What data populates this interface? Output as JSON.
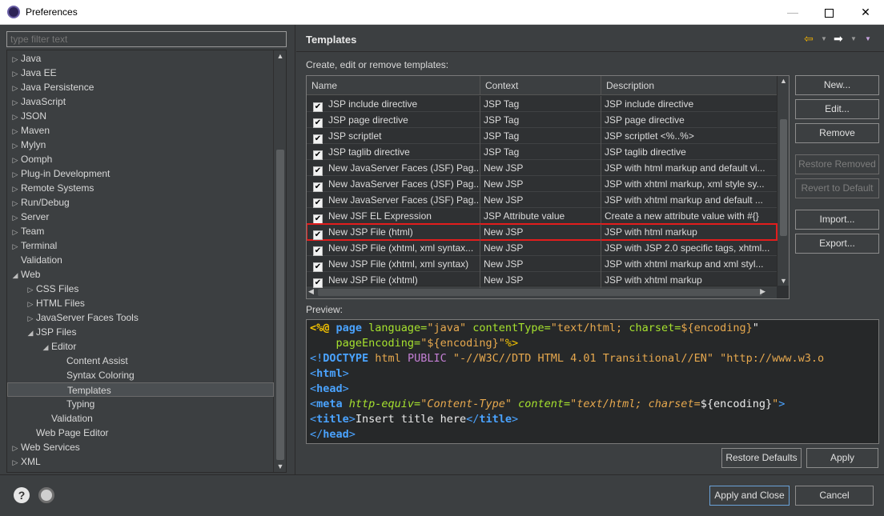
{
  "window": {
    "title": "Preferences"
  },
  "filter": {
    "placeholder": "type filter text"
  },
  "tree": [
    {
      "label": "Java",
      "level": 0,
      "arrow": "▷"
    },
    {
      "label": "Java EE",
      "level": 0,
      "arrow": "▷"
    },
    {
      "label": "Java Persistence",
      "level": 0,
      "arrow": "▷"
    },
    {
      "label": "JavaScript",
      "level": 0,
      "arrow": "▷"
    },
    {
      "label": "JSON",
      "level": 0,
      "arrow": "▷"
    },
    {
      "label": "Maven",
      "level": 0,
      "arrow": "▷"
    },
    {
      "label": "Mylyn",
      "level": 0,
      "arrow": "▷"
    },
    {
      "label": "Oomph",
      "level": 0,
      "arrow": "▷"
    },
    {
      "label": "Plug-in Development",
      "level": 0,
      "arrow": "▷"
    },
    {
      "label": "Remote Systems",
      "level": 0,
      "arrow": "▷"
    },
    {
      "label": "Run/Debug",
      "level": 0,
      "arrow": "▷"
    },
    {
      "label": "Server",
      "level": 0,
      "arrow": "▷"
    },
    {
      "label": "Team",
      "level": 0,
      "arrow": "▷"
    },
    {
      "label": "Terminal",
      "level": 0,
      "arrow": "▷"
    },
    {
      "label": "Validation",
      "level": 0,
      "arrow": ""
    },
    {
      "label": "Web",
      "level": 0,
      "arrow": "◢"
    },
    {
      "label": "CSS Files",
      "level": 1,
      "arrow": "▷"
    },
    {
      "label": "HTML Files",
      "level": 1,
      "arrow": "▷"
    },
    {
      "label": "JavaServer Faces Tools",
      "level": 1,
      "arrow": "▷"
    },
    {
      "label": "JSP Files",
      "level": 1,
      "arrow": "◢"
    },
    {
      "label": "Editor",
      "level": 2,
      "arrow": "◢"
    },
    {
      "label": "Content Assist",
      "level": 3,
      "arrow": ""
    },
    {
      "label": "Syntax Coloring",
      "level": 3,
      "arrow": ""
    },
    {
      "label": "Templates",
      "level": 3,
      "arrow": "",
      "selected": true
    },
    {
      "label": "Typing",
      "level": 3,
      "arrow": ""
    },
    {
      "label": "Validation",
      "level": 2,
      "arrow": ""
    },
    {
      "label": "Web Page Editor",
      "level": 1,
      "arrow": ""
    },
    {
      "label": "Web Services",
      "level": 0,
      "arrow": "▷"
    },
    {
      "label": "XML",
      "level": 0,
      "arrow": "▷"
    }
  ],
  "panel": {
    "title": "Templates",
    "subtitle": "Create, edit or remove templates:",
    "preview_label": "Preview:"
  },
  "table": {
    "columns": [
      "Name",
      "Context",
      "Description"
    ],
    "rows": [
      {
        "name": "JSP include directive",
        "context": "JSP Tag",
        "description": "JSP include directive",
        "checked": true
      },
      {
        "name": "JSP page directive",
        "context": "JSP Tag",
        "description": "JSP page directive",
        "checked": true
      },
      {
        "name": "JSP scriptlet",
        "context": "JSP Tag",
        "description": "JSP scriptlet <%..%>",
        "checked": true
      },
      {
        "name": "JSP taglib directive",
        "context": "JSP Tag",
        "description": "JSP taglib directive",
        "checked": true
      },
      {
        "name": "New JavaServer Faces (JSF) Pag...",
        "context": "New JSP",
        "description": "JSP with html markup and default vi...",
        "checked": true
      },
      {
        "name": "New JavaServer Faces (JSF) Pag...",
        "context": "New JSP",
        "description": "JSP with xhtml markup, xml style sy...",
        "checked": true
      },
      {
        "name": "New JavaServer Faces (JSF) Pag...",
        "context": "New JSP",
        "description": "JSP with xhtml markup and default ...",
        "checked": true
      },
      {
        "name": "New JSF EL Expression",
        "context": "JSP Attribute value",
        "description": "Create a new attribute value with #{}",
        "checked": true
      },
      {
        "name": "New JSP File (html)",
        "context": "New JSP",
        "description": "JSP with html markup",
        "checked": true,
        "highlight": true
      },
      {
        "name": "New JSP File (xhtml, xml syntax...",
        "context": "New JSP",
        "description": "JSP with JSP 2.0 specific tags, xhtml...",
        "checked": true
      },
      {
        "name": "New JSP File (xhtml, xml syntax)",
        "context": "New JSP",
        "description": "JSP with xhtml markup and xml styl...",
        "checked": true
      },
      {
        "name": "New JSP File (xhtml)",
        "context": "New JSP",
        "description": "JSP with xhtml markup",
        "checked": true
      }
    ]
  },
  "side_buttons": [
    {
      "name": "new-button",
      "label": "New...",
      "enabled": true
    },
    {
      "name": "edit-button",
      "label": "Edit...",
      "enabled": true
    },
    {
      "name": "remove-button",
      "label": "Remove",
      "enabled": true
    },
    {
      "name": "restore-removed-button",
      "label": "Restore Removed",
      "enabled": false
    },
    {
      "name": "revert-to-default-button",
      "label": "Revert to Default",
      "enabled": false
    },
    {
      "name": "import-button",
      "label": "Import...",
      "enabled": true
    },
    {
      "name": "export-button",
      "label": "Export...",
      "enabled": true
    }
  ],
  "preview": [
    [
      [
        "<%@ ",
        "c-yel c-bold"
      ],
      [
        "page ",
        "c-blu c-bold"
      ],
      [
        "language=",
        "c-grn"
      ],
      [
        "\"java\" ",
        "c-org"
      ],
      [
        "contentType=",
        "c-grn"
      ],
      [
        "\"text/html; ",
        "c-org"
      ],
      [
        "charset=",
        "c-grn"
      ],
      [
        "${encoding}",
        "c-org"
      ],
      [
        "\"",
        "c-wht"
      ]
    ],
    [
      [
        "    ",
        "c-wht"
      ],
      [
        "pageEncoding=",
        "c-grn"
      ],
      [
        "\"${encoding}\"",
        "c-org"
      ],
      [
        "%>",
        "c-yel"
      ]
    ],
    [
      [
        "<!",
        "c-blu"
      ],
      [
        "DOCTYPE ",
        "c-blu c-bold"
      ],
      [
        "html ",
        "c-org"
      ],
      [
        "PUBLIC ",
        "c-pur"
      ],
      [
        "\"-//W3C//DTD HTML 4.01 Transitional//EN\" ",
        "c-org"
      ],
      [
        "\"http://www.w3.o",
        "c-org"
      ]
    ],
    [
      [
        "<",
        "c-blu"
      ],
      [
        "html",
        "c-blu c-bold"
      ],
      [
        ">",
        "c-blu"
      ]
    ],
    [
      [
        "<",
        "c-blu"
      ],
      [
        "head",
        "c-blu c-bold"
      ],
      [
        ">",
        "c-blu"
      ]
    ],
    [
      [
        "<",
        "c-blu"
      ],
      [
        "meta ",
        "c-blu c-bold"
      ],
      [
        "http-equiv=",
        "c-grn c-ital"
      ],
      [
        "\"Content-Type\" ",
        "c-org c-ital"
      ],
      [
        "content=",
        "c-grn c-ital"
      ],
      [
        "\"text/html; charset=",
        "c-org c-ital"
      ],
      [
        "${encoding}",
        "c-wht"
      ],
      [
        "\"",
        "c-org c-ital"
      ],
      [
        ">",
        "c-blu"
      ]
    ],
    [
      [
        "<",
        "c-blu"
      ],
      [
        "title",
        "c-blu c-bold"
      ],
      [
        ">",
        "c-blu"
      ],
      [
        "Insert title here",
        "c-wht"
      ],
      [
        "</",
        "c-blu"
      ],
      [
        "title",
        "c-blu c-bold"
      ],
      [
        ">",
        "c-blu"
      ]
    ],
    [
      [
        "</",
        "c-blu"
      ],
      [
        "head",
        "c-blu c-bold"
      ],
      [
        ">",
        "c-blu"
      ]
    ]
  ],
  "footer": {
    "restore_defaults": "Restore Defaults",
    "apply": "Apply",
    "apply_and_close": "Apply and Close",
    "cancel": "Cancel"
  },
  "icons": {
    "help": "?",
    "back": "⇦",
    "forward": "➡",
    "dropdown": "▼",
    "check": "✔",
    "scroll_up": "▲",
    "scroll_down": "▼",
    "scroll_left": "◀",
    "scroll_right": "▶",
    "minimize": "—",
    "close": "✕"
  }
}
